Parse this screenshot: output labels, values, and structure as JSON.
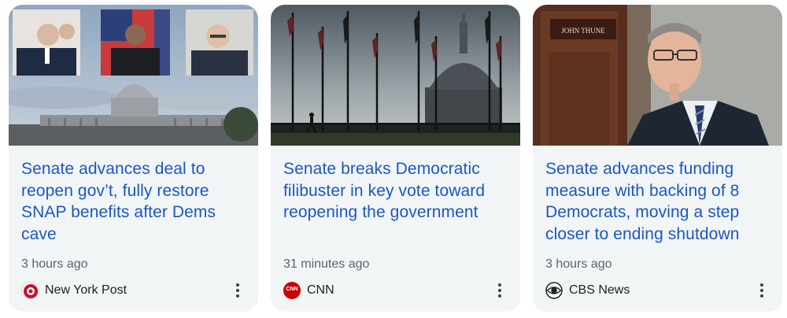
{
  "articles": [
    {
      "headline": "Senate advances deal to reopen gov’t, fully restore SNAP benefits after Dems cave",
      "time": "3 hours ago",
      "source": "New York Post",
      "logo_icon": "new-york-post-logo",
      "logo_color": "#c8102e"
    },
    {
      "headline": "Senate breaks Democratic filibuster in key vote toward reopening the government",
      "time": "31 minutes ago",
      "source": "CNN",
      "logo_icon": "cnn-logo",
      "logo_color": "#cc0000"
    },
    {
      "headline": "Senate advances funding measure with backing of 8 Democrats, moving a step closer to ending shutdown",
      "time": "3 hours ago",
      "source": "CBS News",
      "logo_icon": "cbs-eye-logo",
      "logo_color": "#202124"
    }
  ],
  "door_sign": "JOHN THUNE",
  "logo_text": {
    "cnn": "CNN"
  },
  "colors": {
    "headline": "#1a56c8",
    "card_bg": "#f2f5f6",
    "meta": "#5f6368"
  }
}
